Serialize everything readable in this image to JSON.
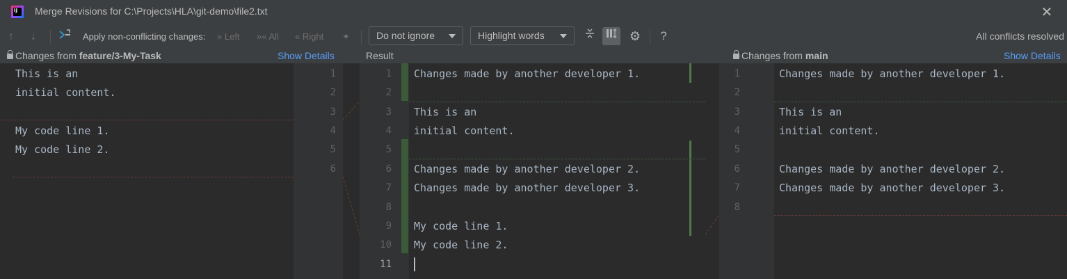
{
  "window": {
    "title": "Merge Revisions for C:\\Projects\\HLA\\git-demo\\file2.txt",
    "close_glyph": "✕",
    "app_icon_text": "IJ"
  },
  "toolbar": {
    "prev_glyph": "↑",
    "next_glyph": "↓",
    "apply_label": "Apply non-conflicting changes:",
    "left_label": "Left",
    "all_label": "All",
    "right_label": "Right",
    "ignore_value": "Do not ignore",
    "highlight_value": "Highlight words",
    "help_glyph": "?",
    "status": "All conflicts resolved"
  },
  "headers": {
    "left_prefix": "Changes from ",
    "left_branch": "feature/3-My-Task",
    "left_details": "Show Details",
    "center": "Result",
    "right_prefix": "Changes from ",
    "right_branch": "main",
    "right_details": "Show Details"
  },
  "left_pane": {
    "lines": [
      "This is an",
      "initial content.",
      "",
      "My code line 1.",
      "My code line 2."
    ],
    "line_numbers": [
      "1",
      "2",
      "3",
      "4",
      "5",
      "6"
    ]
  },
  "result_pane": {
    "line_numbers": [
      "1",
      "2",
      "3",
      "4",
      "5",
      "6",
      "7",
      "8",
      "9",
      "10",
      "11"
    ],
    "lines": [
      "Changes made by another developer 1.",
      "",
      "This is an",
      "initial content.",
      "",
      "Changes made by another developer 2.",
      "Changes made by another developer 3.",
      "",
      "My code line 1.",
      "My code line 2.",
      ""
    ]
  },
  "right_pane": {
    "line_numbers": [
      "1",
      "2",
      "3",
      "4",
      "5",
      "6",
      "7",
      "8"
    ],
    "lines": [
      "Changes made by another developer 1.",
      "",
      "This is an",
      "initial content.",
      "",
      "Changes made by another developer 2.",
      "Changes made by another developer 3.",
      ""
    ]
  },
  "colors": {
    "accent_link": "#589df6",
    "code_text": "#a9b7c6",
    "change_green": "#3c5a3a"
  }
}
